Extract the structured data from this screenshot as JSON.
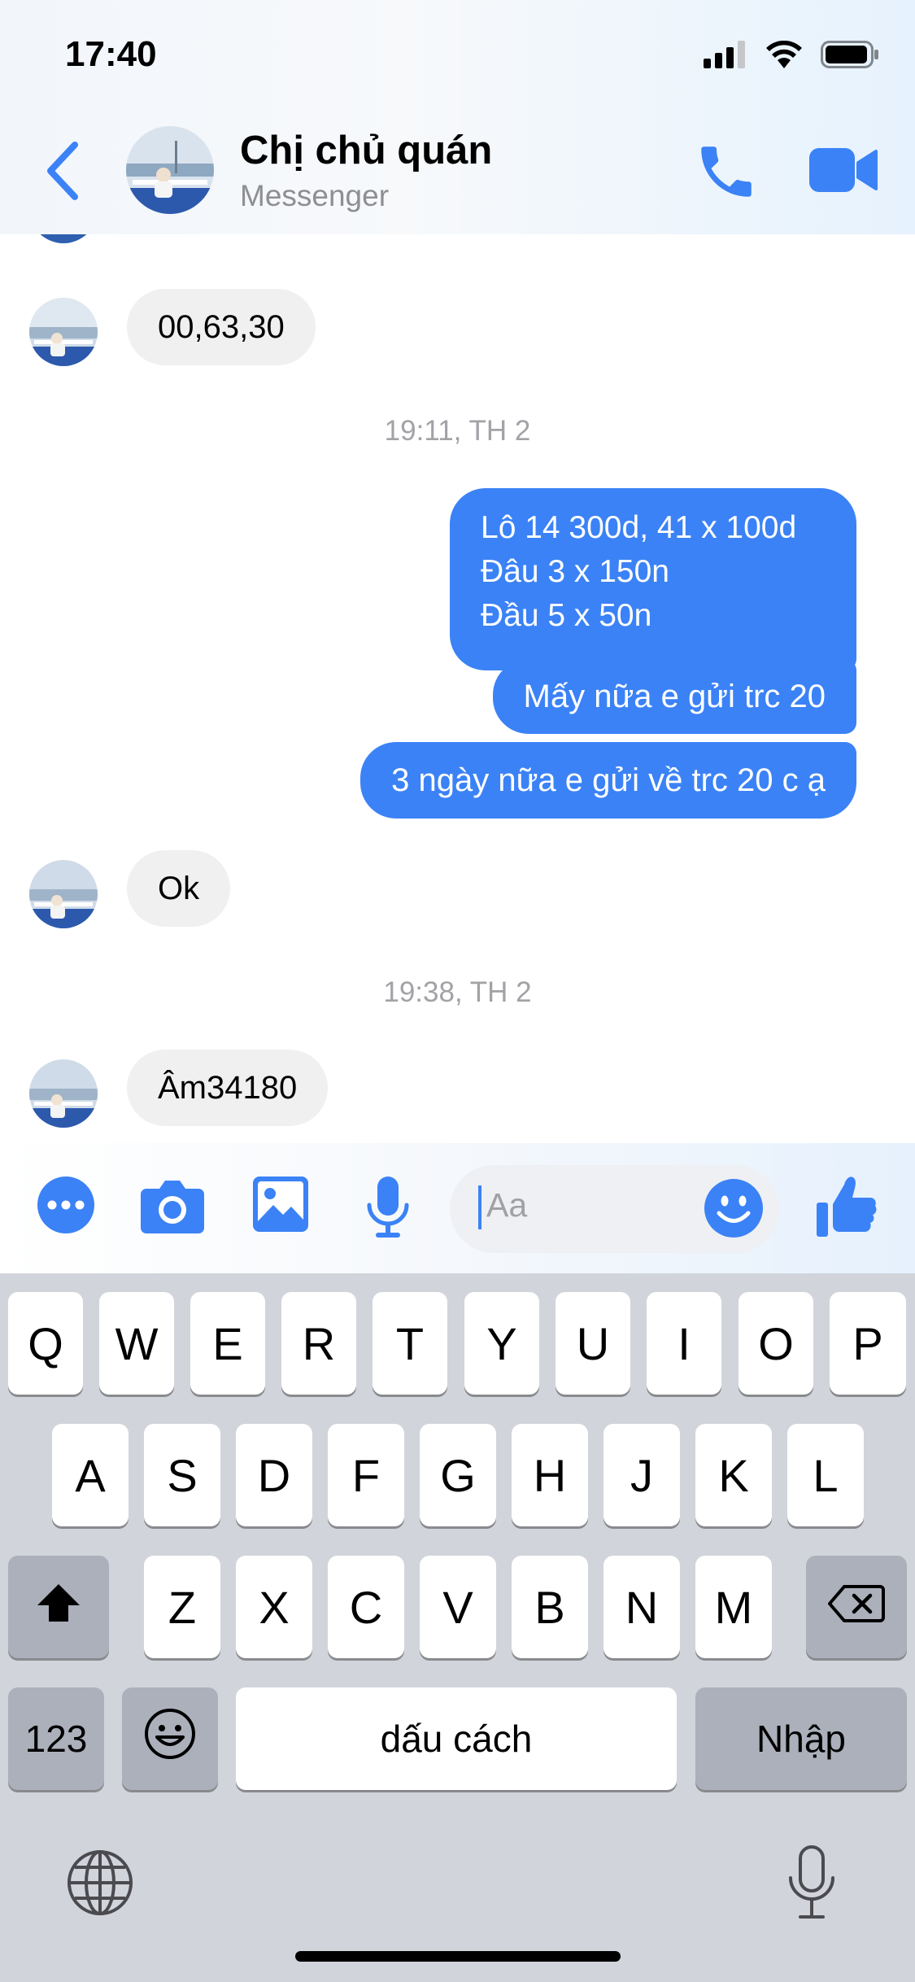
{
  "status_bar": {
    "time": "17:40"
  },
  "header": {
    "contact_name": "Chị chủ quán",
    "subtitle": "Messenger"
  },
  "messages": [
    {
      "type": "incoming",
      "text": "00,63,30"
    },
    {
      "type": "timestamp",
      "text": "19:11, TH 2"
    },
    {
      "type": "outgoing",
      "lines": [
        "Lô 14 300d, 41 x 100d",
        "Đâu 3 x 150n",
        "Đầu 5 x 50n"
      ]
    },
    {
      "type": "outgoing",
      "text": "Mấy nữa e gửi trc 20"
    },
    {
      "type": "outgoing",
      "text": "3 ngày nữa e gửi về trc 20 c ạ"
    },
    {
      "type": "incoming",
      "text": "Ok"
    },
    {
      "type": "timestamp",
      "text": "19:38, TH 2"
    },
    {
      "type": "incoming",
      "text": "Âm34180"
    }
  ],
  "composer": {
    "placeholder": "Aa",
    "tools": [
      "more-icon",
      "camera-icon",
      "photo-icon",
      "microphone-icon"
    ],
    "emoji_icon": "smiley-icon",
    "like_icon": "thumbs-up-icon"
  },
  "keyboard": {
    "row1": [
      "Q",
      "W",
      "E",
      "R",
      "T",
      "Y",
      "U",
      "I",
      "O",
      "P"
    ],
    "row2": [
      "A",
      "S",
      "D",
      "F",
      "G",
      "H",
      "J",
      "K",
      "L"
    ],
    "row3": [
      "Z",
      "X",
      "C",
      "V",
      "B",
      "N",
      "M"
    ],
    "numbers_key": "123",
    "space_key": "dấu cách",
    "return_key": "Nhập"
  },
  "colors": {
    "accent": "#3b82f6",
    "incoming_bubble": "#f0f0f0",
    "keyboard_bg": "#d1d4da"
  }
}
